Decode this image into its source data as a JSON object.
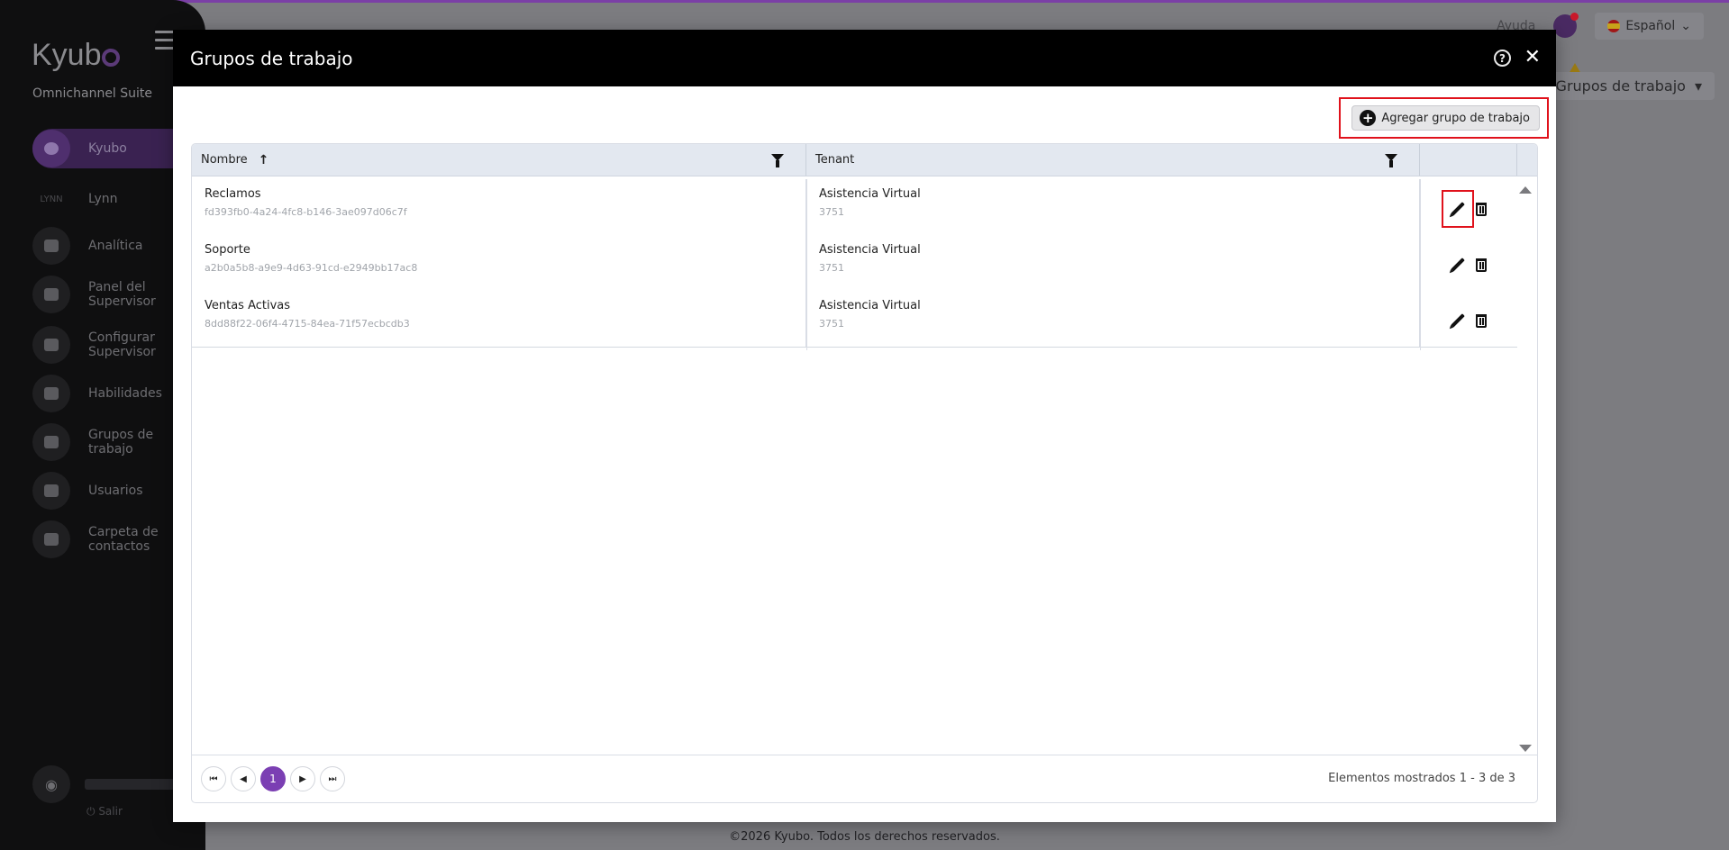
{
  "app": {
    "logo": "Kyubo",
    "suite": "Omnichannel Suite",
    "nav": [
      {
        "label": "Kyubo",
        "icon": "kyubo-icon",
        "active": true
      },
      {
        "label": "Lynn",
        "icon": "lynn-logo"
      },
      {
        "label": "Analítica",
        "icon": "chart-icon"
      },
      {
        "label": "Panel del Supervisor",
        "icon": "gauge-icon"
      },
      {
        "label": "Configurar Supervisor",
        "icon": "user-gear-icon"
      },
      {
        "label": "Habilidades",
        "icon": "medal-icon"
      },
      {
        "label": "Grupos de trabajo",
        "icon": "users-icon"
      },
      {
        "label": "Usuarios",
        "icon": "users-icon"
      },
      {
        "label": "Carpeta de contactos",
        "icon": "folder-icon"
      }
    ],
    "lynn_small": "LYNN",
    "logout": "Salir",
    "header": {
      "help": "Ayuda",
      "language": "Español"
    },
    "breadcrumb": "Grupos de trabajo",
    "footer": "©2026 Kyubo. Todos los derechos reservados."
  },
  "modal": {
    "title": "Grupos de trabajo",
    "add_button": "Agregar grupo de trabajo",
    "columns": {
      "name": "Nombre",
      "tenant": "Tenant"
    },
    "rows": [
      {
        "name": "Reclamos",
        "id": "fd393fb0-4a24-4fc8-b146-3ae097d06c7f",
        "tenant": "Asistencia Virtual",
        "tenant_id": "3751"
      },
      {
        "name": "Soporte",
        "id": "a2b0a5b8-a9e9-4d63-91cd-e2949bb17ac8",
        "tenant": "Asistencia Virtual",
        "tenant_id": "3751"
      },
      {
        "name": "Ventas Activas",
        "id": "8dd88f22-06f4-4715-84ea-71f57ecbcdb3",
        "tenant": "Asistencia Virtual",
        "tenant_id": "3751"
      }
    ],
    "pager": {
      "current_page": "1",
      "info": "Elementos mostrados 1 - 3 de 3"
    }
  }
}
